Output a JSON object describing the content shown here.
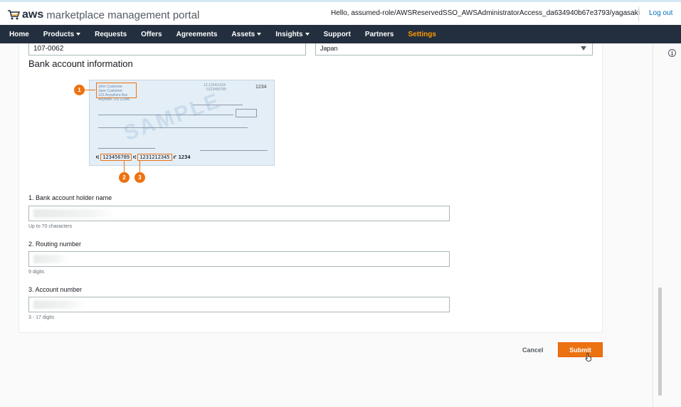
{
  "header": {
    "logo_aws": "aws",
    "logo_text": "marketplace management portal",
    "greeting": "Hello, assumed-role/AWSReservedSSO_AWSAdministratorAccess_da634940b67e3793/yagasaki",
    "logout": "Log out"
  },
  "nav": {
    "items": [
      {
        "label": "Home",
        "dropdown": false
      },
      {
        "label": "Products",
        "dropdown": true
      },
      {
        "label": "Requests",
        "dropdown": false
      },
      {
        "label": "Offers",
        "dropdown": false
      },
      {
        "label": "Agreements",
        "dropdown": false
      },
      {
        "label": "Assets",
        "dropdown": true
      },
      {
        "label": "Insights",
        "dropdown": true
      },
      {
        "label": "Support",
        "dropdown": false
      },
      {
        "label": "Partners",
        "dropdown": false
      },
      {
        "label": "Settings",
        "dropdown": false,
        "active": true
      }
    ]
  },
  "form_top": {
    "postal_code": "107-0062",
    "country": "Japan"
  },
  "bank": {
    "section_title": "Bank account information",
    "check": {
      "name_line1": "John Customer",
      "name_line2": "Jane Customer",
      "name_line3": "123 Anywhere Ave",
      "name_line4": "Anytown, US 12345",
      "routing_top": "12-1234/1234",
      "account_top": "0123456789",
      "check_number": "1234",
      "watermark": "SAMPLE",
      "micr_routing": "123456789",
      "micr_account": "1231212345",
      "micr_check": "1234"
    },
    "callouts": [
      "1",
      "2",
      "3"
    ]
  },
  "fields": [
    {
      "label": "1. Bank account holder name",
      "hint": "Up to 70 characters"
    },
    {
      "label": "2. Routing number",
      "hint": "9 digits"
    },
    {
      "label": "3. Account number",
      "hint": "3 - 17 digits"
    }
  ],
  "actions": {
    "cancel": "Cancel",
    "submit": "Submit"
  },
  "colors": {
    "accent": "#ec7211",
    "nav_bg": "#232f3e",
    "nav_active": "#ff9900",
    "link": "#0073bb"
  },
  "icons": [
    "cart-icon",
    "info-icon",
    "chevron-down-icon",
    "pointer-cursor-icon"
  ]
}
